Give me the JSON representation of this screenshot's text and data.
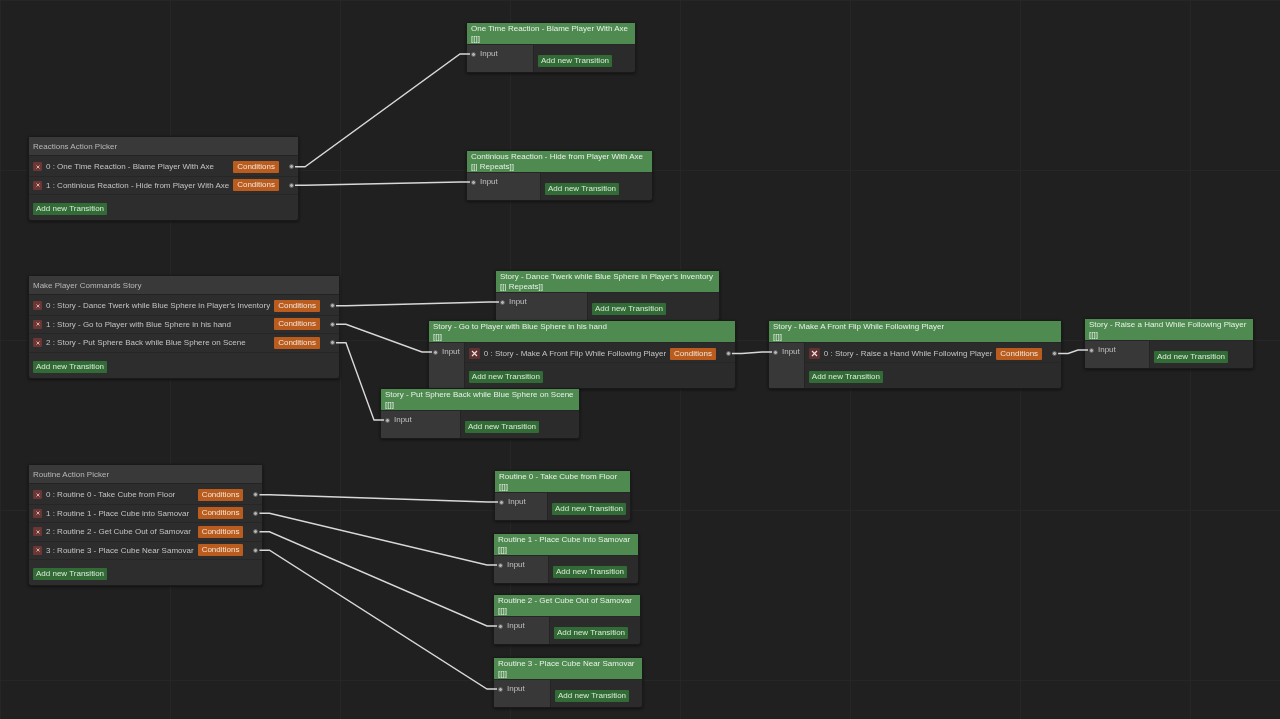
{
  "nodes": [
    {
      "kind": "state",
      "title": "One Time Reaction - Blame Player With Axe",
      "tags": "[[]]",
      "input": "Input",
      "add_button": "Add new Transition"
    },
    {
      "kind": "picker",
      "title": "Reactions Action Picker",
      "transitions": [
        {
          "label": "0 : One Time Reaction - Blame Player With Axe",
          "button": "Conditions"
        },
        {
          "label": "1 : Continious Reaction - Hide from Player With Axe",
          "button": "Conditions"
        }
      ],
      "add_button": "Add new Transition"
    },
    {
      "kind": "state",
      "title": "Continious Reaction - Hide from Player With Axe",
      "tags": "[[| Repeats]]",
      "input": "Input",
      "add_button": "Add new Transition"
    },
    {
      "kind": "picker",
      "title": "Make Player Commands Story",
      "transitions": [
        {
          "label": "0 : Story - Dance Twerk while Blue Sphere in Player's Inventory",
          "button": "Conditions"
        },
        {
          "label": "1 : Story - Go to Player with Blue Sphere in his hand",
          "button": "Conditions"
        },
        {
          "label": "2 : Story - Put Sphere Back while Blue Sphere on Scene",
          "button": "Conditions"
        }
      ],
      "add_button": "Add new Transition"
    },
    {
      "kind": "state",
      "title": "Story - Dance Twerk while Blue Sphere in Player's Inventory",
      "tags": "[[| Repeats]]",
      "input": "Input",
      "add_button": "Add new Transition"
    },
    {
      "kind": "state",
      "title": "Story - Go to Player with Blue Sphere in his hand",
      "tags": "[[]]",
      "input": "Input",
      "transitions": [
        {
          "label": "0 : Story - Make A Front Flip While Following Player",
          "button": "Conditions"
        }
      ],
      "add_button": "Add new Transition"
    },
    {
      "kind": "state",
      "title": "Story - Make A Front Flip While Following Player",
      "tags": "[[]]",
      "input": "Input",
      "transitions": [
        {
          "label": "0 : Story - Raise a Hand While Following Player",
          "button": "Conditions"
        }
      ],
      "add_button": "Add new Transition"
    },
    {
      "kind": "state",
      "title": "Story - Raise a Hand While Following Player",
      "tags": "[[]]",
      "input": "Input",
      "add_button": "Add new Transition"
    },
    {
      "kind": "state",
      "title": "Story - Put Sphere Back while Blue Sphere on Scene",
      "tags": "[[]]",
      "input": "Input",
      "add_button": "Add new Transition"
    },
    {
      "kind": "picker",
      "title": "Routine Action Picker",
      "transitions": [
        {
          "label": "0 : Routine 0 - Take Cube from Floor",
          "button": "Conditions"
        },
        {
          "label": "1 : Routine 1 - Place Cube into Samovar",
          "button": "Conditions"
        },
        {
          "label": "2 : Routine 2 - Get Cube Out of Samovar",
          "button": "Conditions"
        },
        {
          "label": "3 : Routine 3 - Place Cube Near Samovar",
          "button": "Conditions"
        }
      ],
      "add_button": "Add new Transition"
    },
    {
      "kind": "state",
      "title": "Routine 0 - Take Cube from Floor",
      "tags": "[[]]",
      "input": "Input",
      "add_button": "Add new Transition"
    },
    {
      "kind": "state",
      "title": "Routine 1 - Place Cube into Samovar",
      "tags": "[[]]",
      "input": "Input",
      "add_button": "Add new Transition"
    },
    {
      "kind": "state",
      "title": "Routine 2 - Get Cube Out of Samovar",
      "tags": "[[]]",
      "input": "Input",
      "add_button": "Add new Transition"
    },
    {
      "kind": "state",
      "title": "Routine 3 - Place Cube Near Samovar",
      "tags": "[[]]",
      "input": "Input",
      "add_button": "Add new Transition"
    }
  ]
}
